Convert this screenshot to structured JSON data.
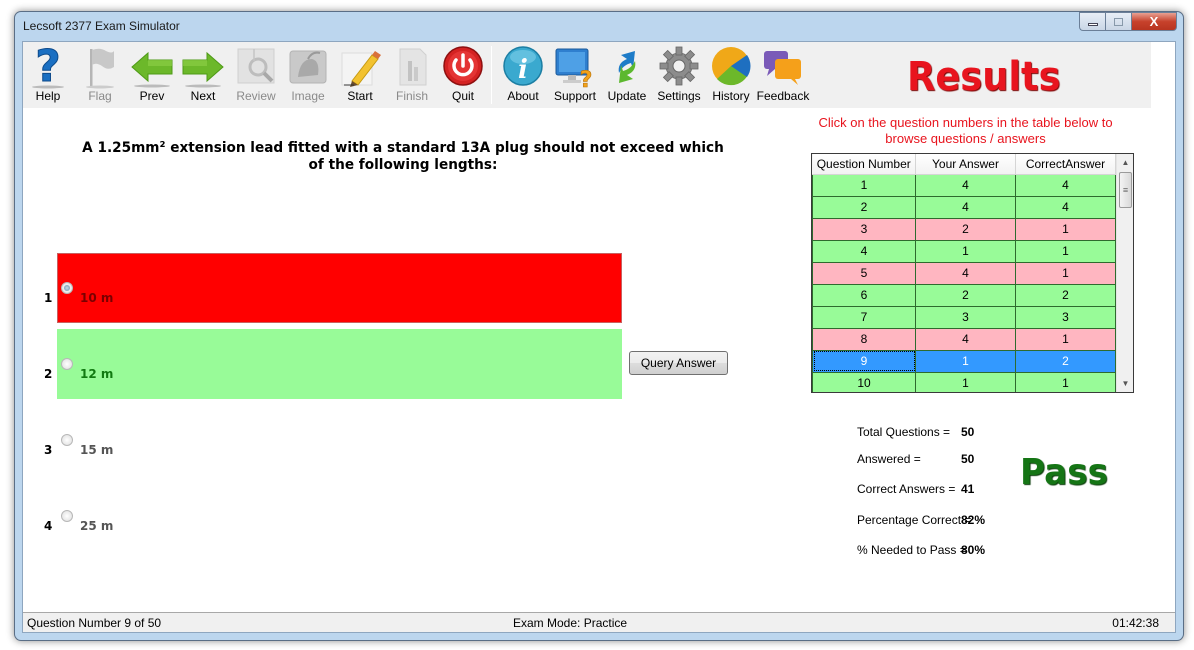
{
  "window": {
    "title": "Lecsoft 2377 Exam Simulator",
    "controls": {
      "minimize": "minimize",
      "maximize": "maximize",
      "close": "X"
    }
  },
  "toolbar": {
    "buttons": [
      {
        "label": "Help",
        "icon": "help-icon",
        "enabled": true
      },
      {
        "label": "Flag",
        "icon": "flag-icon",
        "enabled": false
      },
      {
        "label": "Prev",
        "icon": "arrow-left-icon",
        "enabled": true
      },
      {
        "label": "Next",
        "icon": "arrow-right-icon",
        "enabled": true
      },
      {
        "label": "Review",
        "icon": "review-magnifier-icon",
        "enabled": false
      },
      {
        "label": "Image",
        "icon": "image-icon",
        "enabled": false
      },
      {
        "label": "Start",
        "icon": "start-pencil-icon",
        "enabled": true
      },
      {
        "label": "Finish",
        "icon": "finish-document-icon",
        "enabled": false
      },
      {
        "label": "Quit",
        "icon": "power-icon",
        "enabled": true
      },
      {
        "label": "About",
        "icon": "info-icon",
        "enabled": true
      },
      {
        "label": "Support",
        "icon": "support-monitor-icon",
        "enabled": true
      },
      {
        "label": "Update",
        "icon": "update-arrows-icon",
        "enabled": true
      },
      {
        "label": "Settings",
        "icon": "gear-icon",
        "enabled": true
      },
      {
        "label": "History",
        "icon": "pie-chart-icon",
        "enabled": true
      },
      {
        "label": "Feedback",
        "icon": "speech-bubbles-icon",
        "enabled": true
      }
    ]
  },
  "results_title": "Results",
  "question": {
    "text": "A 1.25mm² extension lead fitted with a standard 13A plug should not exceed which of the following lengths:",
    "options": [
      {
        "number": "1",
        "text": "10 m",
        "state": "wrong-selected",
        "selected": true
      },
      {
        "number": "2",
        "text": "12 m",
        "state": "correct",
        "selected": false
      },
      {
        "number": "3",
        "text": "15 m",
        "state": "neutral",
        "selected": false
      },
      {
        "number": "4",
        "text": "25 m",
        "state": "neutral",
        "selected": false
      }
    ],
    "query_button": "Query Answer"
  },
  "instructions": "Click on the question numbers in the table below to browse questions / answers",
  "results_table": {
    "columns": [
      "Question Number",
      "Your Answer",
      "CorrectAnswer"
    ],
    "rows": [
      {
        "q": "1",
        "yours": "4",
        "correct": "4",
        "status": "correct"
      },
      {
        "q": "2",
        "yours": "4",
        "correct": "4",
        "status": "correct"
      },
      {
        "q": "3",
        "yours": "2",
        "correct": "1",
        "status": "wrong"
      },
      {
        "q": "4",
        "yours": "1",
        "correct": "1",
        "status": "correct"
      },
      {
        "q": "5",
        "yours": "4",
        "correct": "1",
        "status": "wrong"
      },
      {
        "q": "6",
        "yours": "2",
        "correct": "2",
        "status": "correct"
      },
      {
        "q": "7",
        "yours": "3",
        "correct": "3",
        "status": "correct"
      },
      {
        "q": "8",
        "yours": "4",
        "correct": "1",
        "status": "wrong"
      },
      {
        "q": "9",
        "yours": "1",
        "correct": "2",
        "status": "selected"
      },
      {
        "q": "10",
        "yours": "1",
        "correct": "1",
        "status": "correct"
      }
    ]
  },
  "stats": [
    {
      "label": "Total Questions =",
      "value": "50"
    },
    {
      "label": "Answered =",
      "value": "50"
    },
    {
      "label": "Correct Answers =",
      "value": "41"
    },
    {
      "label": "Percentage Correct =",
      "value": "82%"
    },
    {
      "label": "% Needed to Pass =",
      "value": "80%"
    }
  ],
  "result": "Pass",
  "colors": {
    "wrong_option": "#ff0000",
    "correct_option": "#98fb98",
    "row_correct": "#98fb98",
    "row_wrong": "#ffb6c1",
    "row_selected": "#3399ff",
    "results_title": "#e8141e",
    "pass": "#157515"
  },
  "statusbar": {
    "question_position": "Question Number 9 of 50",
    "exam_mode": "Exam Mode: Practice",
    "timer": "01:42:38"
  }
}
